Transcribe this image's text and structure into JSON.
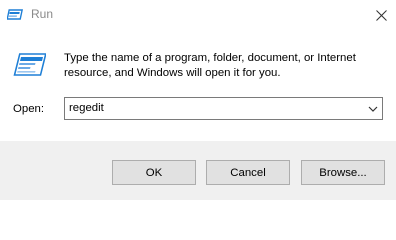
{
  "window": {
    "title": "Run",
    "close_icon": "close-icon",
    "app_icon": "run-icon"
  },
  "body": {
    "message": "Type the name of a program, folder, document, or Internet resource, and Windows will open it for you.",
    "open_label": "Open:",
    "input_value": "regedit"
  },
  "buttons": {
    "ok": "OK",
    "cancel": "Cancel",
    "browse": "Browse..."
  },
  "colors": {
    "title_text": "#8a8a8a",
    "footer_bg": "#f0f0f0",
    "button_bg": "#e1e1e1",
    "icon_blue": "#1e7fd6"
  }
}
